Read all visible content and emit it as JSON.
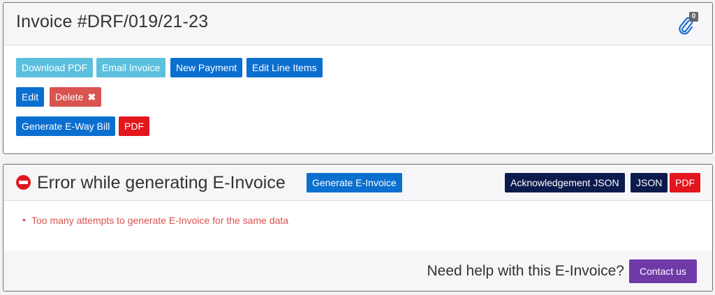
{
  "invoice": {
    "title": "Invoice #DRF/019/21-23",
    "attachment_count": "0"
  },
  "actions": {
    "download_pdf": "Download PDF",
    "email_invoice": "Email Invoice",
    "new_payment": "New Payment",
    "edit_line_items": "Edit Line Items",
    "edit": "Edit",
    "delete": "Delete",
    "generate_eway_bill": "Generate E-Way Bill",
    "pdf": "PDF"
  },
  "einvoice": {
    "error_title": "Error while generating E-Invoice",
    "generate_button": "Generate E-Invoice",
    "ack_json": "Acknowledgement JSON",
    "json": "JSON",
    "pdf": "PDF",
    "errors": [
      "Too many attempts to generate E-Invoice for the same data"
    ],
    "help_text": "Need help with this E-Invoice?",
    "contact": "Contact us"
  }
}
